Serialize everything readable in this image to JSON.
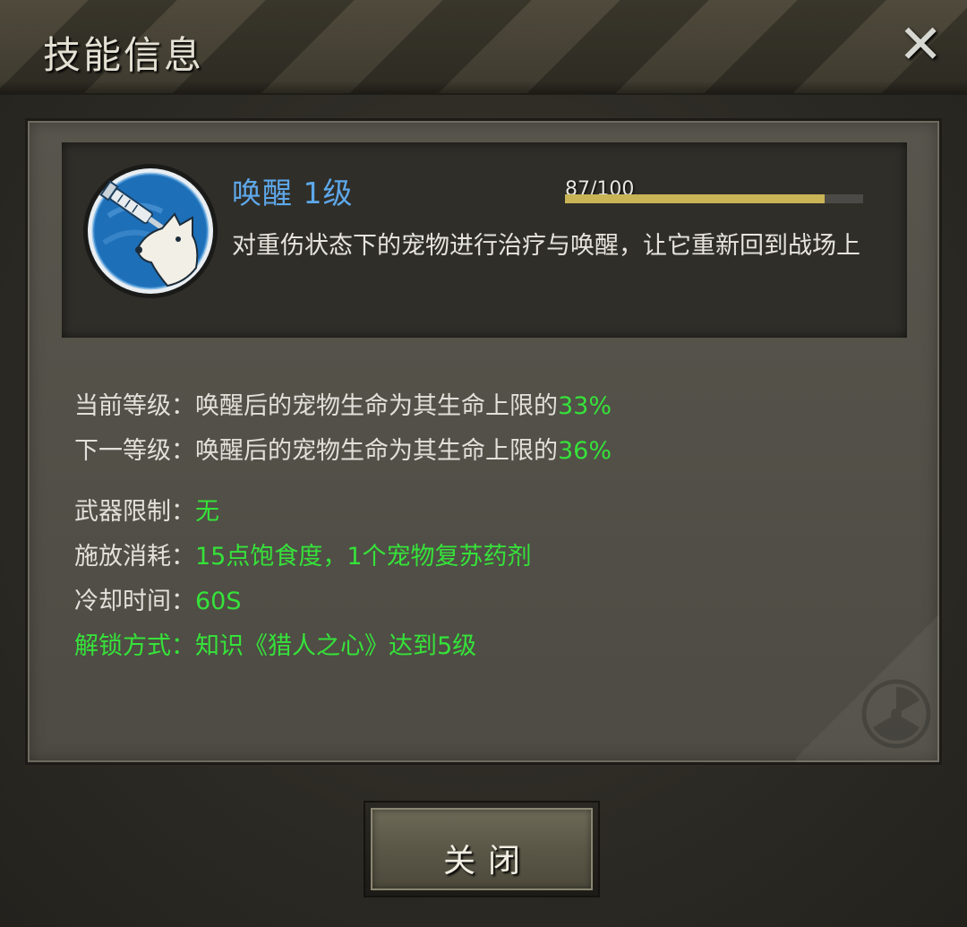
{
  "header": {
    "title": "技能信息"
  },
  "skill": {
    "name": "唤醒 1级",
    "xp_text": "87/100",
    "xp_current": 87,
    "xp_max": 100,
    "description": "对重伤状态下的宠物进行治疗与唤醒，让它重新回到战场上"
  },
  "info": {
    "current_level_label": "当前等级：唤醒后的宠物生命为其生命上限的",
    "current_level_value": "33%",
    "next_level_label": "下一等级：唤醒后的宠物生命为其生命上限的",
    "next_level_value": "36%",
    "weapon_label": "武器限制：",
    "weapon_value": "无",
    "cost_label": "施放消耗：",
    "cost_value": "15点饱食度，1个宠物复苏药剂",
    "cooldown_label": "冷却时间：",
    "cooldown_value": "60S",
    "unlock_text": "解锁方式：知识《猎人之心》达到5级"
  },
  "buttons": {
    "close_label": "关闭"
  },
  "colors": {
    "skill_name": "#5ea8ea",
    "highlight_green": "#36e23a",
    "xp_fill": "#c9b456"
  },
  "icons": {
    "close": "close-x-icon",
    "skill": "syringe-dog-icon",
    "hazard": "radiation-icon"
  }
}
